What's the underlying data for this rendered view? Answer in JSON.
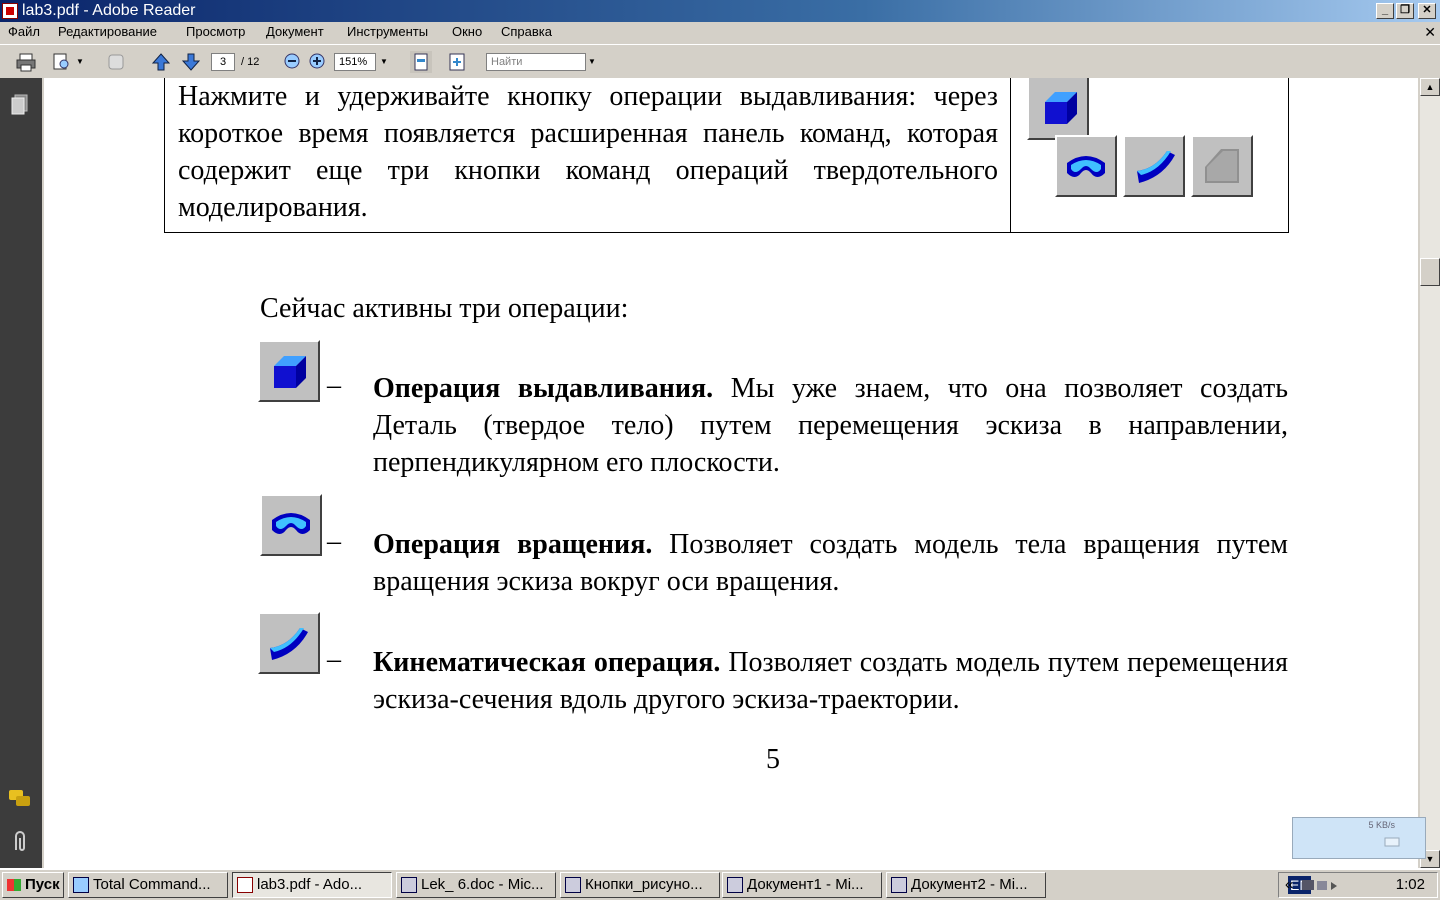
{
  "window": {
    "title": "lab3.pdf - Adobe Reader"
  },
  "menu": [
    "Файл",
    "Редактирование",
    "Просмотр",
    "Документ",
    "Инструменты",
    "Окно",
    "Справка"
  ],
  "toolbar": {
    "page_current": "3",
    "page_total": "/ 12",
    "zoom": "151%",
    "find_placeholder": "Найти"
  },
  "document": {
    "box_text": "Нажмите и удерживайте кнопку операции выдавливания: через короткое время появляется расширенная панель команд, которая содержит еще три кнопки команд операций твердотельного моделирования.",
    "heading": "Сейчас активны три операции:",
    "items": [
      {
        "dash": "–",
        "title": "Операция выдавливания.",
        "text": " Мы уже знаем, что она позволяет создать Деталь (твердое тело) путем перемещения эскиза в направлении, перпендикулярном его плоскости."
      },
      {
        "dash": "–",
        "title": "Операция вращения.",
        "text": " Позволяет создать модель тела вращения путем вращения эскиза вокруг оси вращения."
      },
      {
        "dash": "–",
        "title": "Кинематическая операция.",
        "text": " Позволяет создать модель путем перемещения эскиза-сечения вдоль другого эскиза-траектории."
      }
    ],
    "page_number": "5"
  },
  "net_widget": {
    "speed": "5 KB/s"
  },
  "taskbar": {
    "start": "Пуск",
    "tasks": [
      "Total Command...",
      "lab3.pdf - Ado...",
      "Lek_ 6.doc - Mic...",
      "Кнопки_рисуно...",
      "Документ1 - Mi...",
      "Документ2 - Mi..."
    ],
    "lang": "EN",
    "clock": "1:02"
  }
}
